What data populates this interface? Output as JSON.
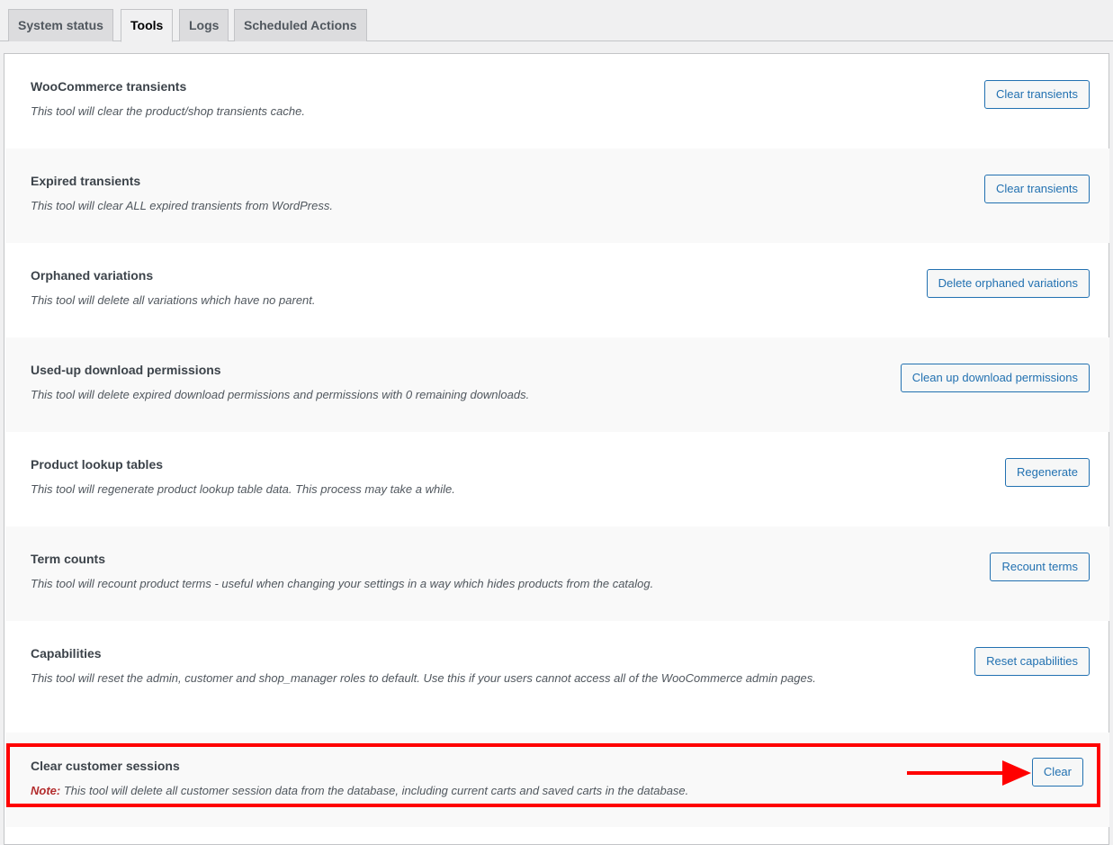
{
  "tabs": [
    {
      "label": "System status",
      "active": false
    },
    {
      "label": "Tools",
      "active": true
    },
    {
      "label": "Logs",
      "active": false
    },
    {
      "label": "Scheduled Actions",
      "active": false
    }
  ],
  "tools": [
    {
      "title": "WooCommerce transients",
      "description": "This tool will clear the product/shop transients cache.",
      "button": "Clear transients"
    },
    {
      "title": "Expired transients",
      "description": "This tool will clear ALL expired transients from WordPress.",
      "button": "Clear transients"
    },
    {
      "title": "Orphaned variations",
      "description": "This tool will delete all variations which have no parent.",
      "button": "Delete orphaned variations"
    },
    {
      "title": "Used-up download permissions",
      "description": "This tool will delete expired download permissions and permissions with 0 remaining downloads.",
      "button": "Clean up download permissions"
    },
    {
      "title": "Product lookup tables",
      "description": "This tool will regenerate product lookup table data. This process may take a while.",
      "button": "Regenerate"
    },
    {
      "title": "Term counts",
      "description": "This tool will recount product terms - useful when changing your settings in a way which hides products from the catalog.",
      "button": "Recount terms"
    },
    {
      "title": "Capabilities",
      "description": "This tool will reset the admin, customer and shop_manager roles to default. Use this if your users cannot access all of the WooCommerce admin pages.",
      "button": "Reset capabilities"
    },
    {
      "title": "Clear customer sessions",
      "note_label": "Note:",
      "description": "This tool will delete all customer session data from the database, including current carts and saved carts in the database.",
      "button": "Clear"
    }
  ],
  "annotation": {
    "highlight_color": "#ff0000",
    "arrow_color": "#ff0000"
  },
  "colors": {
    "accent": "#2271b1",
    "note": "#b32d2e"
  }
}
